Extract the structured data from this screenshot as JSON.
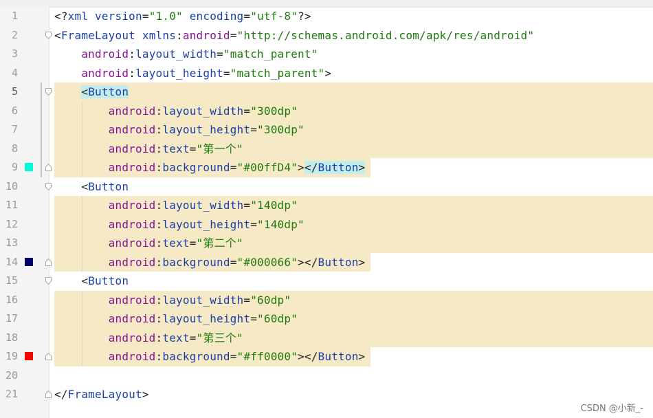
{
  "line_numbers": [
    "1",
    "2",
    "3",
    "4",
    "5",
    "6",
    "7",
    "8",
    "9",
    "10",
    "11",
    "12",
    "13",
    "14",
    "15",
    "16",
    "17",
    "18",
    "19",
    "20",
    "21"
  ],
  "code": {
    "l1": {
      "open": "<?",
      "kw": "xml",
      "a1": "version",
      "eq1": "=",
      "v1": "\"1.0\"",
      "a2": "encoding",
      "eq2": "=",
      "v2": "\"utf-8\"",
      "close": "?>"
    },
    "l2": {
      "lt": "<",
      "tag": "FrameLayout",
      "a": "xmlns",
      "colon": ":",
      "ns": "android",
      "eq": "=",
      "v": "\"http://schemas.android.com/apk/res/android\""
    },
    "l3": {
      "ns": "android",
      "colon": ":",
      "a": "layout_width",
      "eq": "=",
      "v": "\"match_parent\""
    },
    "l4": {
      "ns": "android",
      "colon": ":",
      "a": "layout_height",
      "eq": "=",
      "v": "\"match_parent\"",
      "gt": ">"
    },
    "l5": {
      "lt": "<",
      "tag": "Button"
    },
    "l6": {
      "ns": "android",
      "colon": ":",
      "a": "layout_width",
      "eq": "=",
      "v": "\"300dp\""
    },
    "l7": {
      "ns": "android",
      "colon": ":",
      "a": "layout_height",
      "eq": "=",
      "v": "\"300dp\""
    },
    "l8": {
      "ns": "android",
      "colon": ":",
      "a": "text",
      "eq": "=",
      "v": "\"第一个\""
    },
    "l9": {
      "ns": "android",
      "colon": ":",
      "a": "background",
      "eq": "=",
      "v": "\"#00ffD4\"",
      "gt": ">",
      "ct": "</",
      "ctag": "Button",
      "cgt": ">"
    },
    "l10": {
      "lt": "<",
      "tag": "Button"
    },
    "l11": {
      "ns": "android",
      "colon": ":",
      "a": "layout_width",
      "eq": "=",
      "v": "\"140dp\""
    },
    "l12": {
      "ns": "android",
      "colon": ":",
      "a": "layout_height",
      "eq": "=",
      "v": "\"140dp\""
    },
    "l13": {
      "ns": "android",
      "colon": ":",
      "a": "text",
      "eq": "=",
      "v": "\"第二个\""
    },
    "l14": {
      "ns": "android",
      "colon": ":",
      "a": "background",
      "eq": "=",
      "v": "\"#000066\"",
      "gt": ">",
      "ct": "</",
      "ctag": "Button",
      "cgt": ">"
    },
    "l15": {
      "lt": "<",
      "tag": "Button"
    },
    "l16": {
      "ns": "android",
      "colon": ":",
      "a": "layout_width",
      "eq": "=",
      "v": "\"60dp\""
    },
    "l17": {
      "ns": "android",
      "colon": ":",
      "a": "layout_height",
      "eq": "=",
      "v": "\"60dp\""
    },
    "l18": {
      "ns": "android",
      "colon": ":",
      "a": "text",
      "eq": "=",
      "v": "\"第三个\""
    },
    "l19": {
      "ns": "android",
      "colon": ":",
      "a": "background",
      "eq": "=",
      "v": "\"#ff0000\"",
      "gt": ">",
      "ct": "</",
      "ctag": "Button",
      "cgt": ">"
    },
    "l21": {
      "ct": "</",
      "ctag": "FrameLayout",
      "cgt": ">"
    }
  },
  "swatch_colors": {
    "cyan": "#00ffd4",
    "navy": "#000066",
    "red": "#ff0000"
  },
  "colors": {
    "background": "#ffffff",
    "gutter": "#f4f4f4",
    "highlight_band": "#f5eac5",
    "tag_match": "#c3ecec",
    "tag": "#1a3fa8",
    "namespace": "#871094",
    "value": "#1d7a0c"
  },
  "icons": {
    "fold_open": "fold-open-icon",
    "fold_close": "fold-close-icon",
    "color_swatch": "color-swatch-icon"
  },
  "watermark": "CSDN @小新_-"
}
